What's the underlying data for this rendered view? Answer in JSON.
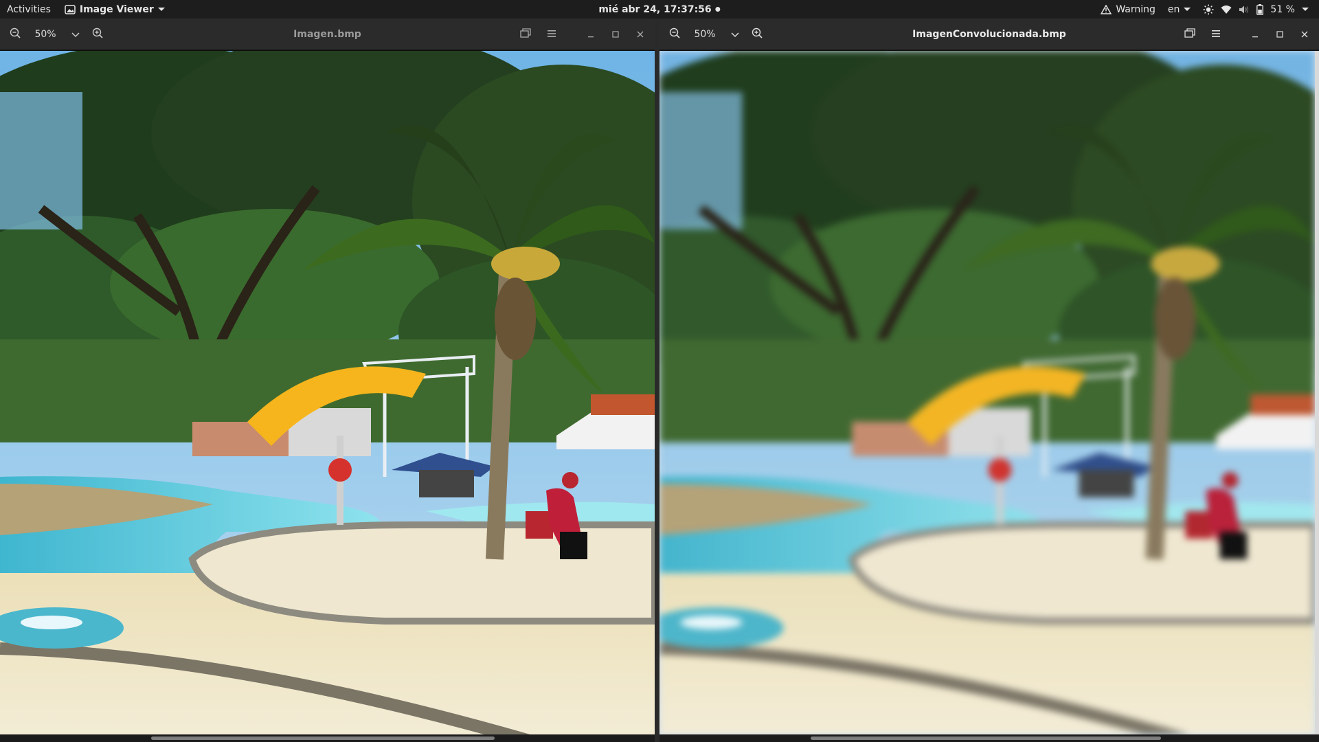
{
  "topbar": {
    "activities": "Activities",
    "app_menu": "Image Viewer",
    "datetime": "mié abr 24, 17:37:56",
    "warning": "Warning",
    "language": "en",
    "battery": "51 %"
  },
  "windows": [
    {
      "title": "Imagen.bmp",
      "zoom": "50%",
      "active": false
    },
    {
      "title": "ImagenConvolucionada.bmp",
      "zoom": "50%",
      "active": true
    }
  ],
  "colors": {
    "topbar_bg": "#1d1d1d",
    "headerbar_bg": "#2b2b2b",
    "pool_water": "#5fd0e0",
    "canopy_yellow": "#f6b51c"
  },
  "icons": [
    "image-viewer-icon",
    "zoom-out-icon",
    "zoom-in-icon",
    "chevron-down-icon",
    "gallery-icon",
    "menu-icon",
    "minimize-icon",
    "maximize-icon",
    "close-icon",
    "warning-icon",
    "brightness-icon",
    "wifi-icon",
    "volume-icon",
    "battery-icon"
  ]
}
